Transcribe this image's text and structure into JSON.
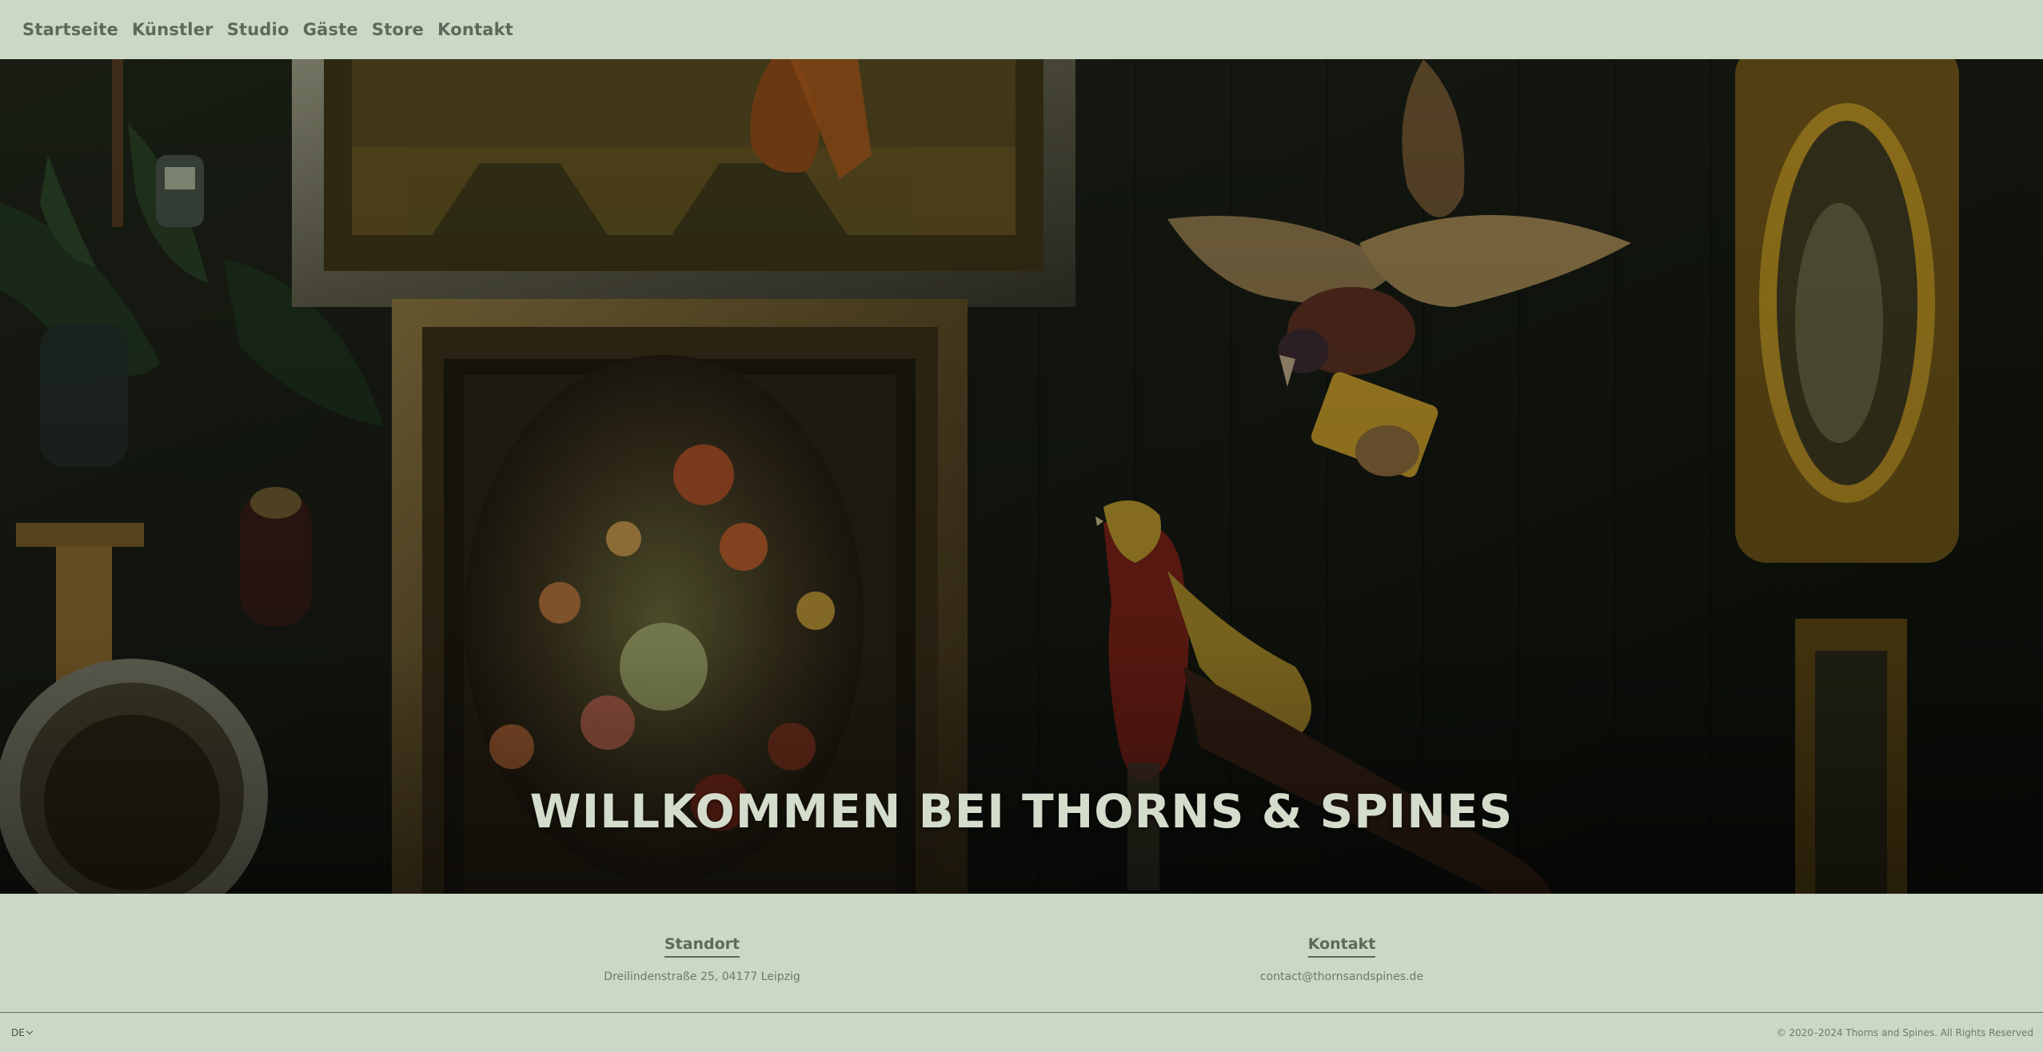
{
  "nav": {
    "items": [
      {
        "label": "Startseite"
      },
      {
        "label": "Künstler"
      },
      {
        "label": "Studio"
      },
      {
        "label": "Gäste"
      },
      {
        "label": "Store"
      },
      {
        "label": "Kontakt"
      }
    ]
  },
  "hero": {
    "title": "WILLKOMMEN BEI THORNS & SPINES"
  },
  "footer": {
    "standort": {
      "heading": "Standort",
      "address": "Dreilindenstraße 25, 04177 Leipzig"
    },
    "kontakt": {
      "heading": "Kontakt",
      "email": "contact@thornsandspines.de"
    }
  },
  "bottombar": {
    "language": "DE",
    "copyright": "© 2020–2024 Thorns and Spines. All Rights Reserved"
  },
  "colors": {
    "background": "#ccd8c6",
    "text": "#5c6a5a",
    "hero_overlay": "#141710"
  }
}
